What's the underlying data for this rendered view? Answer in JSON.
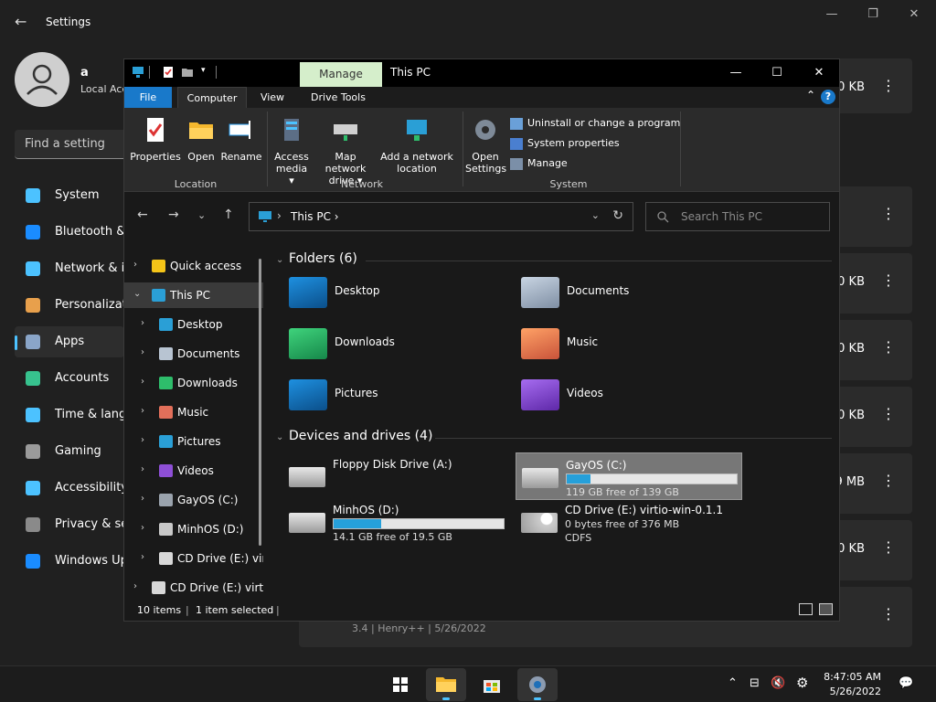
{
  "settings": {
    "title": "Settings",
    "user_name": "a",
    "user_sub": "Local Acc",
    "search_placeholder": "Find a setting",
    "nav": [
      {
        "label": "System",
        "icon": "monitor-icon",
        "color": "#4cc2ff"
      },
      {
        "label": "Bluetooth &",
        "icon": "bluetooth-icon",
        "color": "#1a8cff"
      },
      {
        "label": "Network & i",
        "icon": "wifi-icon",
        "color": "#4cc2ff"
      },
      {
        "label": "Personalizat",
        "icon": "brush-icon",
        "color": "#e8a04c"
      },
      {
        "label": "Apps",
        "icon": "apps-icon",
        "color": "#8aa5c8"
      },
      {
        "label": "Accounts",
        "icon": "person-icon",
        "color": "#37c28e"
      },
      {
        "label": "Time & lang",
        "icon": "clock-globe-icon",
        "color": "#4cc2ff"
      },
      {
        "label": "Gaming",
        "icon": "controller-icon",
        "color": "#9a9a9a"
      },
      {
        "label": "Accessibility",
        "icon": "accessibility-icon",
        "color": "#4cc2ff"
      },
      {
        "label": "Privacy & se",
        "icon": "shield-icon",
        "color": "#8a8a8a"
      },
      {
        "label": "Windows Up",
        "icon": "update-icon",
        "color": "#1a8cff"
      }
    ],
    "rows": [
      {
        "size": "0 KB"
      },
      {
        "size": ""
      },
      {
        "size": "0 KB"
      },
      {
        "size": "0 KB"
      },
      {
        "size": "0 KB"
      },
      {
        "size": "9 MB"
      },
      {
        "size": "0 KB"
      },
      {
        "size": ""
      }
    ],
    "footer_meta": "3.4   |   Henry++   |   5/26/2022"
  },
  "explorer": {
    "title": "This PC",
    "manage_tab": "Manage",
    "tabs": [
      "File",
      "Computer",
      "View",
      "Drive Tools"
    ],
    "ribbon": {
      "location_group": "Location",
      "network_group": "Network",
      "system_group": "System",
      "properties": "Properties",
      "open": "Open",
      "rename": "Rename",
      "access_media": "Access media ▾",
      "map_network": "Map network drive ▾",
      "add_network": "Add a network location",
      "open_settings": "Open Settings",
      "uninstall": "Uninstall or change a program",
      "system_properties": "System properties",
      "manage": "Manage"
    },
    "address": {
      "crumb": "This PC  ›",
      "search_placeholder": "Search This PC"
    },
    "tree": [
      {
        "label": "Quick access",
        "icon": "star-icon",
        "color": "#f5c518",
        "indent": 0,
        "expanded": false
      },
      {
        "label": "This PC",
        "icon": "computer-icon",
        "color": "#2a9fd6",
        "indent": 0,
        "expanded": true,
        "selected": true
      },
      {
        "label": "Desktop",
        "icon": "desktop-folder-icon",
        "color": "#2a9fd6",
        "indent": 1
      },
      {
        "label": "Documents",
        "icon": "documents-folder-icon",
        "color": "#b8c4d2",
        "indent": 1
      },
      {
        "label": "Downloads",
        "icon": "downloads-icon",
        "color": "#2ebd6b",
        "indent": 1
      },
      {
        "label": "Music",
        "icon": "music-icon",
        "color": "#e26f5a",
        "indent": 1
      },
      {
        "label": "Pictures",
        "icon": "pictures-icon",
        "color": "#2a9fd6",
        "indent": 1
      },
      {
        "label": "Videos",
        "icon": "videos-icon",
        "color": "#8e4fd6",
        "indent": 1
      },
      {
        "label": "GayOS (C:)",
        "icon": "os-drive-icon",
        "color": "#9aa3ad",
        "indent": 1
      },
      {
        "label": "MinhOS (D:)",
        "icon": "drive-icon",
        "color": "#c8c8c8",
        "indent": 1
      },
      {
        "label": "CD Drive (E:) vir",
        "icon": "cd-drive-icon",
        "color": "#d8d8d8",
        "indent": 1
      },
      {
        "label": "CD Drive (E:) virti",
        "icon": "cd-drive-icon",
        "color": "#d8d8d8",
        "indent": 0
      }
    ],
    "folders_header": "Folders (6)",
    "folders": [
      {
        "label": "Desktop",
        "icon": "desktop-folder-icon",
        "color": "#1e90e0"
      },
      {
        "label": "Documents",
        "icon": "documents-folder-icon",
        "color": "#a8b6c8"
      },
      {
        "label": "Downloads",
        "icon": "downloads-folder-icon",
        "color": "#2ebd6b"
      },
      {
        "label": "Music",
        "icon": "music-folder-icon",
        "color": "#f08a4b"
      },
      {
        "label": "Pictures",
        "icon": "pictures-folder-icon",
        "color": "#1e90e0"
      },
      {
        "label": "Videos",
        "icon": "videos-folder-icon",
        "color": "#8e4fd6"
      }
    ],
    "drives_header": "Devices and drives (4)",
    "drives": [
      {
        "name": "Floppy Disk Drive (A:)",
        "type": "floppy"
      },
      {
        "name": "GayOS (C:)",
        "free": "119 GB free of 139 GB",
        "used_fraction": 0.14,
        "selected": true
      },
      {
        "name": "MinhOS (D:)",
        "free": "14.1 GB free of 19.5 GB",
        "used_fraction": 0.28
      },
      {
        "name": "CD Drive (E:) virtio-win-0.1.1",
        "line2": "0 bytes free of 376 MB",
        "line3": "CDFS",
        "type": "cd"
      }
    ],
    "status": {
      "items": "10 items",
      "selected": "1 item selected"
    }
  },
  "taskbar": {
    "time": "8:47:05 AM",
    "date": "5/26/2022"
  }
}
